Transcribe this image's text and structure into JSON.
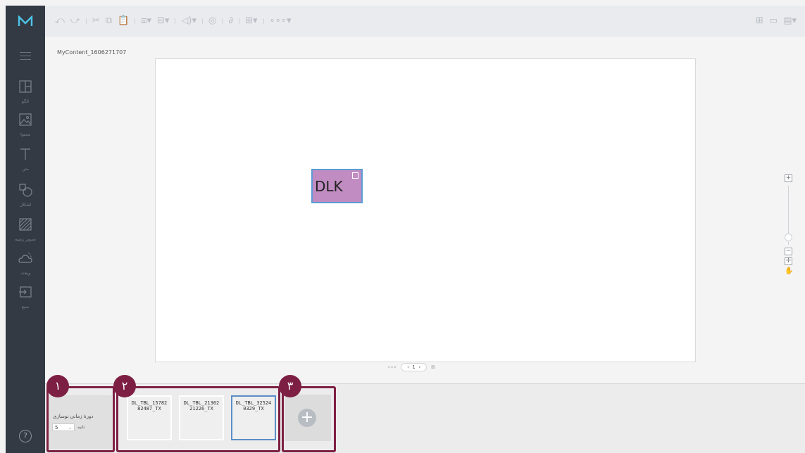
{
  "app": {
    "logo": "M",
    "content_name": "MyContent_1606271707"
  },
  "sidebar": {
    "items": [
      {
        "label": "الگو",
        "icon": "layout-icon"
      },
      {
        "label": "محتوا",
        "icon": "image-icon"
      },
      {
        "label": "متن",
        "icon": "text-icon"
      },
      {
        "label": "اشکال",
        "icon": "shapes-icon"
      },
      {
        "label": "تصویر زمینه",
        "icon": "background-pattern-icon"
      },
      {
        "label": "ویجت",
        "icon": "weather-widget-icon"
      },
      {
        "label": "منبع",
        "icon": "source-import-icon"
      }
    ],
    "help": "?"
  },
  "canvas": {
    "element_text": "DLK",
    "page_number": "1"
  },
  "bottom": {
    "markers": [
      "١",
      "٢",
      "٣"
    ],
    "duration_label": "دورهٔ زمانی نوسازی",
    "duration_value": "5",
    "duration_unit": "ثانیه",
    "pages": [
      {
        "label": "DL_TBL_1578282487_TX",
        "line1": "DL_TBL_15782",
        "line2": "82487_TX"
      },
      {
        "label": "DL_TBL_2136221226_TX",
        "line1": "DL_TBL_21362",
        "line2": "21226_TX"
      },
      {
        "label": "DL_TBL_325240329_TX",
        "line1": "DL_TBL_32524",
        "line2": "0329_TX"
      }
    ],
    "add_symbol": "+"
  },
  "colors": {
    "accent": "#7d1f43",
    "sidebar": "#333a43",
    "selection": "#5b9bd5",
    "element_fill": "#c08cc1"
  }
}
